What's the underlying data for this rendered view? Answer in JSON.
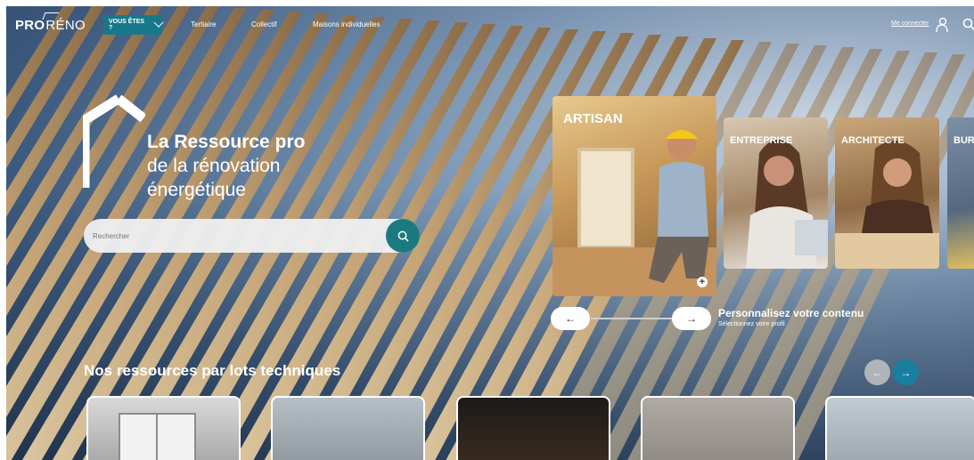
{
  "header": {
    "logo_pro": "PRO",
    "logo_reno": "RÉNO",
    "vous_etes": "VOUS ÊTES ?",
    "nav_links": [
      "Tertiaire",
      "Collectif",
      "Maisons individuelles"
    ],
    "connect": "Me connecter"
  },
  "hero": {
    "tagline_1": "La Ressource pro",
    "tagline_2": "de la rénovation",
    "tagline_3": "énergétique",
    "search_placeholder": "Rechercher"
  },
  "profiles": [
    {
      "label": "ARTISAN"
    },
    {
      "label": "ENTREPRISE"
    },
    {
      "label": "ARCHITECTE"
    },
    {
      "label": "BUR"
    }
  ],
  "personalize": {
    "title": "Personnalisez votre contenu",
    "subtitle": "Sélectionnez votre profil"
  },
  "lots": {
    "title": "Nos ressources par lots techniques"
  },
  "colors": {
    "accent_teal": "#17788a",
    "search_button": "#1b7a80",
    "next_button": "#187fa0"
  }
}
